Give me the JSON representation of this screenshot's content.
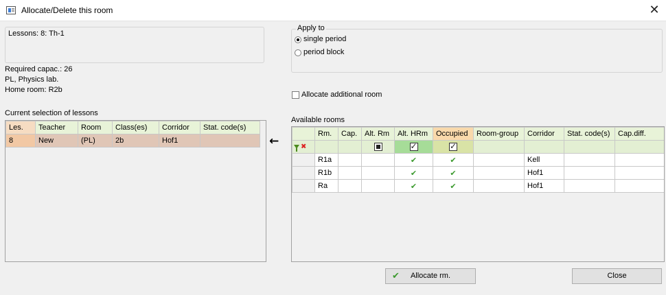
{
  "window": {
    "title": "Allocate/Delete this room",
    "close_glyph": "✕"
  },
  "lesson_info": {
    "lessons": "Lessons: 8: Th-1",
    "required_capac": "Required capac.: 26",
    "room_desc": "PL, Physics lab.",
    "home_room": "Home room: R2b"
  },
  "apply_to": {
    "legend": "Apply to",
    "options": [
      {
        "label": "single period",
        "selected": true
      },
      {
        "label": "period block",
        "selected": false
      }
    ]
  },
  "allocate_additional": {
    "label": "Allocate additional room",
    "checked": false
  },
  "current_selection": {
    "label": "Current selection of lessons",
    "columns": [
      "Les.",
      "Teacher",
      "Room",
      "Class(es)",
      "Corridor",
      "Stat. code(s)"
    ],
    "rows": [
      {
        "les": "8",
        "teacher": "New",
        "room": "(PL)",
        "classes": "2b",
        "corridor": "Hof1",
        "stat": ""
      }
    ]
  },
  "move_arrow": "🡐",
  "available_rooms": {
    "label": "Available rooms",
    "columns": [
      "Rm.",
      "Cap.",
      "Alt. Rm",
      "Alt. HRm",
      "Occupied",
      "Room-group",
      "Corridor",
      "Stat. code(s)",
      "Cap.diff."
    ],
    "filter": {
      "filter_icon": "funnel-icon",
      "clear_icon": "red-x-icon",
      "alt_rm": "indeterminate",
      "alt_hrm": "checked",
      "occupied": "checked"
    },
    "rows": [
      {
        "rm": "R1a",
        "cap": "",
        "alt_rm": "",
        "alt_hrm": "✔",
        "occupied": "✔",
        "room_group": "",
        "corridor": "Kell",
        "stat": "",
        "cap_diff": ""
      },
      {
        "rm": "R1b",
        "cap": "",
        "alt_rm": "",
        "alt_hrm": "✔",
        "occupied": "✔",
        "room_group": "",
        "corridor": "Hof1",
        "stat": "",
        "cap_diff": ""
      },
      {
        "rm": "Ra",
        "cap": "",
        "alt_rm": "",
        "alt_hrm": "✔",
        "occupied": "✔",
        "room_group": "",
        "corridor": "Hof1",
        "stat": "",
        "cap_diff": ""
      }
    ]
  },
  "buttons": {
    "allocate": {
      "label": "Allocate rm.",
      "icon_glyph": "✔"
    },
    "close": {
      "label": "Close"
    }
  },
  "colors": {
    "accent_green": "#3c9a2f",
    "header_green": "#e8f3d8",
    "row_highlight": "#e0c6b6",
    "occupied_header": "#f9d9ab"
  }
}
